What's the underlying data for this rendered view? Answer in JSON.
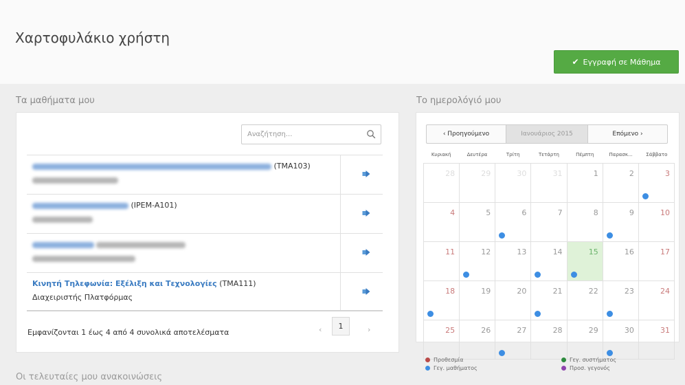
{
  "header": {
    "title": "Χαρτοφυλάκιο χρήστη",
    "register_label": "Εγγραφή σε Μάθημα"
  },
  "courses": {
    "heading": "Τα μαθήματα μου",
    "search_placeholder": "Αναζήτηση...",
    "rows": [
      {
        "code": "(TMA103)",
        "name": "",
        "role": ""
      },
      {
        "code": "(IPEM-A101)",
        "name": "",
        "role": ""
      },
      {
        "code": "",
        "name": "",
        "role": ""
      },
      {
        "code": "(TMA111)",
        "name": "Κινητή Τηλεφωνία: Εξέλιξη και Τεχνολογίες",
        "role": "Διαχειριστής Πλατφόρμας"
      }
    ],
    "results_info": "Εμφανίζονται 1 έως 4 από 4 συνολικά αποτελέσματα",
    "pager": {
      "prev": "‹",
      "page": "1",
      "next": "›"
    }
  },
  "calendar": {
    "heading": "Το ημερολόγιό μου",
    "prev_label": "‹ Προηγούμενο",
    "month_label": "Ιανουάριος 2015",
    "next_label": "Επόμενο ›",
    "weekdays": [
      "Κυριακή",
      "Δευτέρα",
      "Τρίτη",
      "Τετάρτη",
      "Πέμπτη",
      "Παρασκ...",
      "Σάββατο"
    ],
    "days": [
      {
        "n": "28",
        "other": true
      },
      {
        "n": "29",
        "other": true
      },
      {
        "n": "30",
        "other": true
      },
      {
        "n": "31",
        "other": true
      },
      {
        "n": "1"
      },
      {
        "n": "2"
      },
      {
        "n": "3",
        "dot": true
      },
      {
        "n": "4"
      },
      {
        "n": "5"
      },
      {
        "n": "6",
        "dot": true
      },
      {
        "n": "7"
      },
      {
        "n": "8"
      },
      {
        "n": "9",
        "dot": true
      },
      {
        "n": "10"
      },
      {
        "n": "11"
      },
      {
        "n": "12",
        "dot": true
      },
      {
        "n": "13"
      },
      {
        "n": "14",
        "dot": true
      },
      {
        "n": "15",
        "today": true,
        "dot": true
      },
      {
        "n": "16"
      },
      {
        "n": "17"
      },
      {
        "n": "18",
        "dot": true
      },
      {
        "n": "19"
      },
      {
        "n": "20"
      },
      {
        "n": "21",
        "dot": true
      },
      {
        "n": "22"
      },
      {
        "n": "23",
        "dot": true
      },
      {
        "n": "24"
      },
      {
        "n": "25"
      },
      {
        "n": "26"
      },
      {
        "n": "27",
        "dot": true
      },
      {
        "n": "28"
      },
      {
        "n": "29"
      },
      {
        "n": "30",
        "dot": true
      },
      {
        "n": "31"
      }
    ],
    "legend": [
      {
        "label": "Προθεσμία",
        "color": "#b94a48"
      },
      {
        "label": "Γεγ. συστήματος",
        "color": "#2e8b3e"
      },
      {
        "label": "Γεγ. μαθήματος",
        "color": "#3d8ee3"
      },
      {
        "label": "Προσ. γεγονός",
        "color": "#8e44ad"
      }
    ]
  },
  "announcements": {
    "heading": "Οι τελευταίες μου ανακοινώσεις"
  },
  "colors": {
    "accent_green": "#55aa44",
    "link_blue": "#3a7bc1",
    "event_dot": "#3d8ee3",
    "today_bg": "#dff2d8"
  }
}
